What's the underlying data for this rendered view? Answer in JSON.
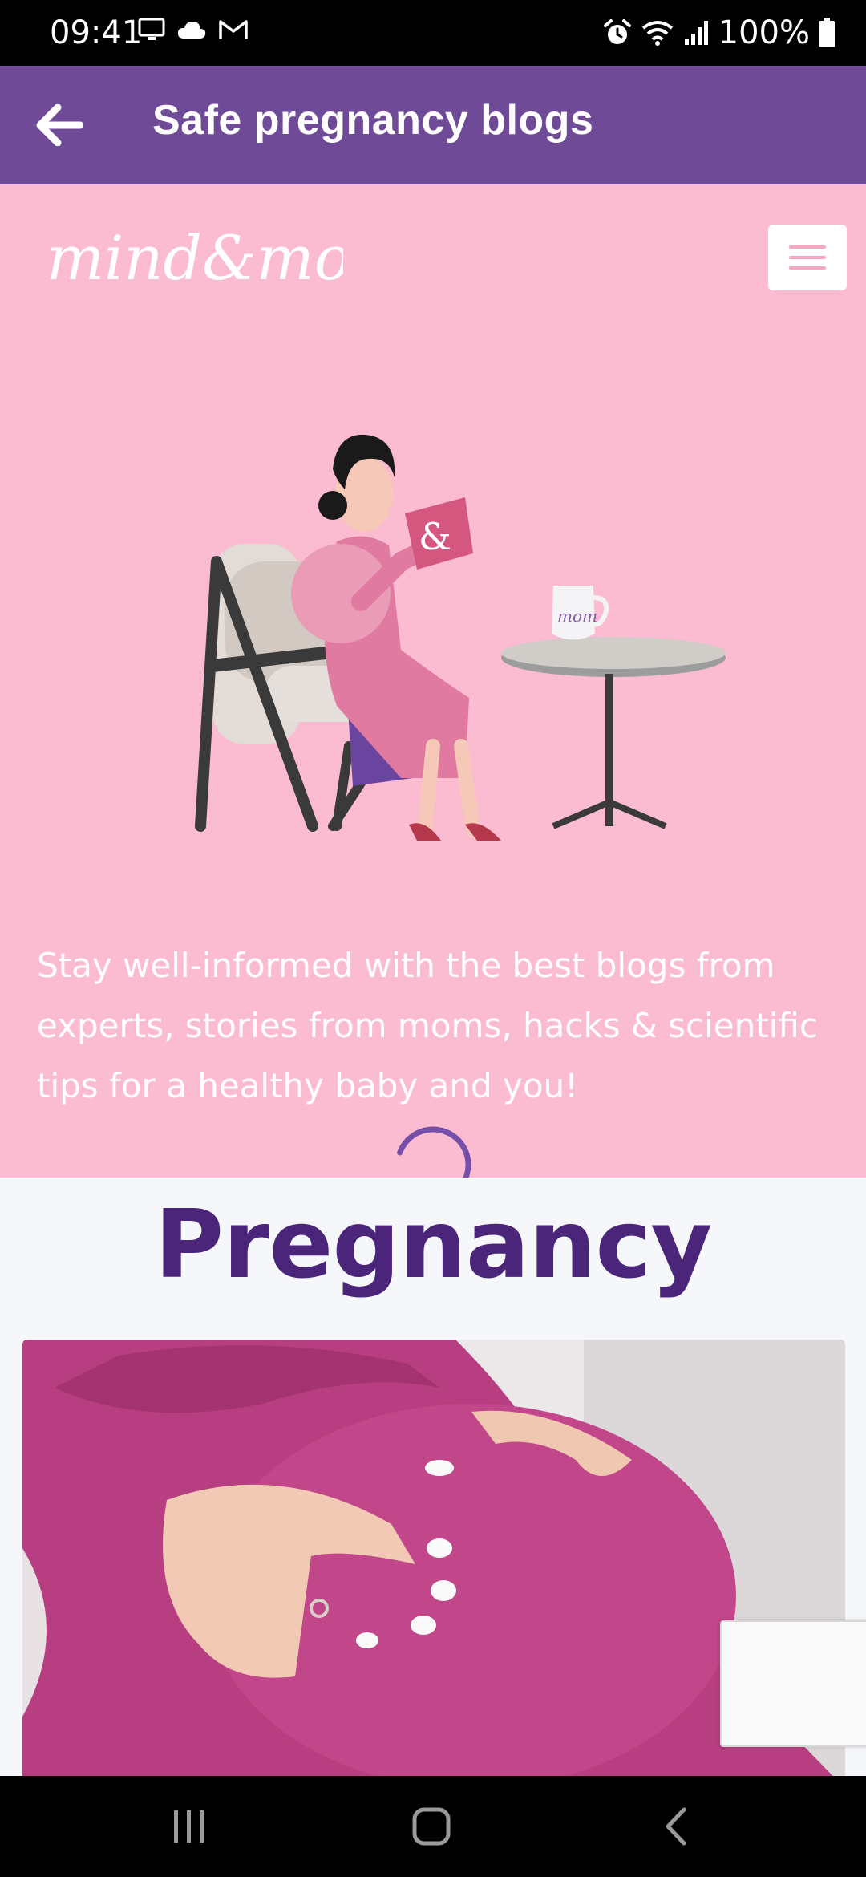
{
  "status_bar": {
    "time": "09:41",
    "battery": "100%",
    "icons": [
      "monitor-icon",
      "cloud-icon",
      "gmail-icon",
      "alarm-icon",
      "wifi-icon",
      "signal-icon",
      "battery-icon"
    ]
  },
  "app_bar": {
    "title": "Safe pregnancy blogs",
    "back_icon": "arrow-left-icon",
    "color": "#6f4a97"
  },
  "hero": {
    "logo_text": "mind&mom",
    "menu_icon": "hamburger-icon",
    "description": "Stay well-informed with the best blogs from experts, stories from moms, hacks & scientific tips for a healthy baby and you!",
    "background": "#fbbcd2",
    "illustration": {
      "book_text": "&",
      "mug_text": "mom"
    }
  },
  "section": {
    "heading": "Pregnancy",
    "heading_color": "#4b2579"
  },
  "nav_bar": {
    "recent_icon": "recent-apps-icon",
    "home_icon": "home-icon",
    "back_icon": "back-icon"
  }
}
